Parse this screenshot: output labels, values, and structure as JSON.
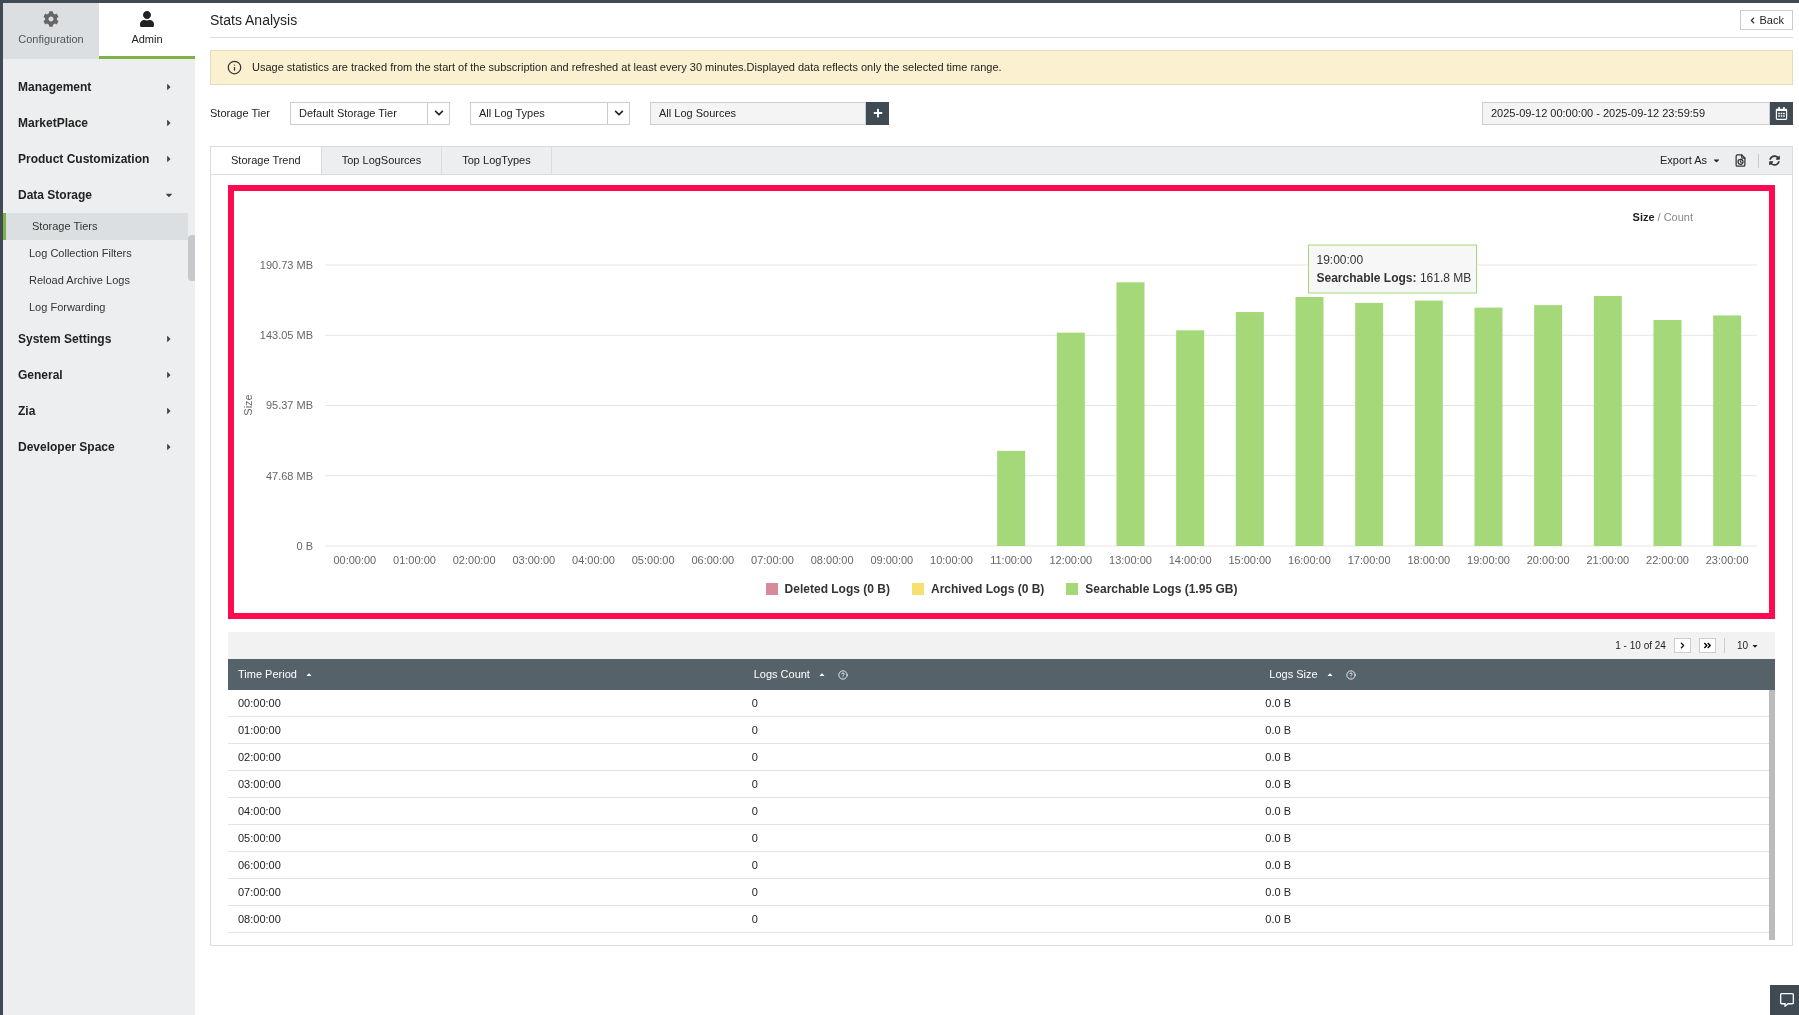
{
  "top_tabs": [
    {
      "label": "Configuration",
      "selected": false
    },
    {
      "label": "Admin",
      "selected": true
    }
  ],
  "sidebar": {
    "items": [
      {
        "label": "Management",
        "expanded": false
      },
      {
        "label": "MarketPlace",
        "expanded": false
      },
      {
        "label": "Product Customization",
        "expanded": false
      },
      {
        "label": "Data Storage",
        "expanded": true,
        "children": [
          {
            "label": "Storage Tiers",
            "selected": true
          },
          {
            "label": "Log Collection Filters",
            "selected": false
          },
          {
            "label": "Reload Archive Logs",
            "selected": false
          },
          {
            "label": "Log Forwarding",
            "selected": false
          }
        ]
      },
      {
        "label": "System Settings",
        "expanded": false
      },
      {
        "label": "General",
        "expanded": false
      },
      {
        "label": "Zia",
        "expanded": false
      },
      {
        "label": "Developer Space",
        "expanded": false
      }
    ]
  },
  "page": {
    "title": "Stats Analysis",
    "back": "Back"
  },
  "info_banner": "Usage statistics are tracked from the start of the subscription and refreshed at least every 30 minutes.Displayed data reflects only the selected time range.",
  "filters": {
    "storage_tier_label": "Storage Tier",
    "storage_tier": "Default Storage Tier",
    "log_types": "All Log Types",
    "log_sources": "All Log Sources",
    "date_range": "2025-09-12 00:00:00 - 2025-09-12 23:59:59"
  },
  "tabs": [
    {
      "label": "Storage Trend",
      "selected": true
    },
    {
      "label": "Top LogSources",
      "selected": false
    },
    {
      "label": "Top LogTypes",
      "selected": false
    }
  ],
  "toolbar": {
    "export": "Export As"
  },
  "chart_toggle": {
    "size": "Size",
    "separator": "/",
    "count": "Count",
    "size_selected": true
  },
  "chart_tooltip": {
    "title": "19:00:00",
    "label": "Searchable Logs:",
    "value": "161.8 MB"
  },
  "chart_data": {
    "type": "bar",
    "ylabel": "Size",
    "stacked": true,
    "grid": true,
    "categories": [
      "00:00:00",
      "01:00:00",
      "02:00:00",
      "03:00:00",
      "04:00:00",
      "05:00:00",
      "06:00:00",
      "07:00:00",
      "08:00:00",
      "09:00:00",
      "10:00:00",
      "11:00:00",
      "12:00:00",
      "13:00:00",
      "14:00:00",
      "15:00:00",
      "16:00:00",
      "17:00:00",
      "18:00:00",
      "19:00:00",
      "20:00:00",
      "21:00:00",
      "22:00:00",
      "23:00:00"
    ],
    "ylim": [
      0,
      190.73
    ],
    "yticks": [
      {
        "value": 0,
        "label": "0 B"
      },
      {
        "value": 47.68,
        "label": "47.68 MB"
      },
      {
        "value": 95.37,
        "label": "95.37 MB"
      },
      {
        "value": 143.05,
        "label": "143.05 MB"
      },
      {
        "value": 190.73,
        "label": "190.73 MB"
      }
    ],
    "series": [
      {
        "name": "Deleted Logs (0 B)",
        "color": "#d98a9a",
        "values": [
          0,
          0,
          0,
          0,
          0,
          0,
          0,
          0,
          0,
          0,
          0,
          0,
          0,
          0,
          0,
          0,
          0,
          0,
          0,
          0,
          0,
          0,
          0,
          0
        ]
      },
      {
        "name": "Archived Logs (0 B)",
        "color": "#f5e070",
        "values": [
          0,
          0,
          0,
          0,
          0,
          0,
          0,
          0,
          0,
          0,
          0,
          0,
          0,
          0,
          0,
          0,
          0,
          0,
          0,
          0,
          0,
          0,
          0,
          0
        ]
      },
      {
        "name": "Searchable Logs (1.95 GB)",
        "color": "#a5d878",
        "values": [
          0,
          0,
          0,
          0,
          0,
          0,
          0,
          0,
          0,
          0,
          0,
          64.6,
          144.8,
          179,
          146.4,
          158.8,
          169,
          165,
          166.6,
          161.8,
          163.5,
          169.7,
          153.4,
          156.5
        ]
      }
    ]
  },
  "pagination": {
    "range": "1 - 10 of 24",
    "page_size": "10"
  },
  "table": {
    "columns": [
      "Time Period",
      "Logs Count",
      "Logs Size"
    ],
    "rows": [
      [
        "00:00:00",
        "0",
        "0.0 B"
      ],
      [
        "01:00:00",
        "0",
        "0.0 B"
      ],
      [
        "02:00:00",
        "0",
        "0.0 B"
      ],
      [
        "03:00:00",
        "0",
        "0.0 B"
      ],
      [
        "04:00:00",
        "0",
        "0.0 B"
      ],
      [
        "05:00:00",
        "0",
        "0.0 B"
      ],
      [
        "06:00:00",
        "0",
        "0.0 B"
      ],
      [
        "07:00:00",
        "0",
        "0.0 B"
      ],
      [
        "08:00:00",
        "0",
        "0.0 B"
      ]
    ]
  }
}
